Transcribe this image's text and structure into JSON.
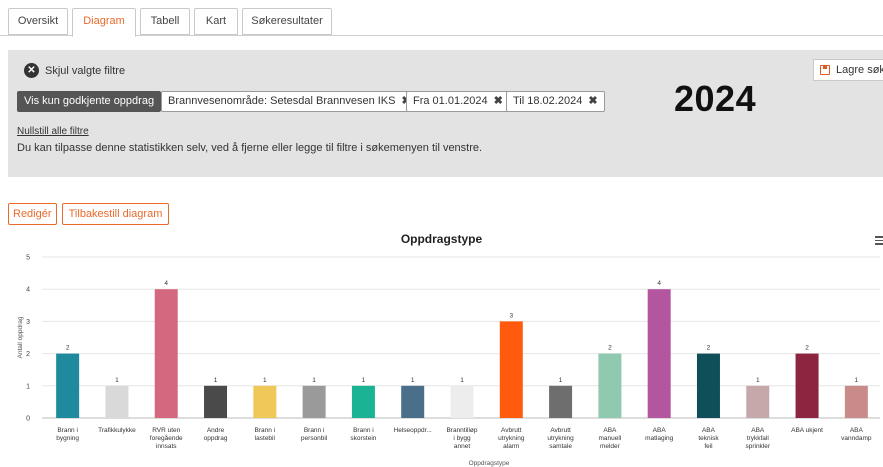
{
  "tabs": [
    {
      "label": "Oversikt",
      "active": false
    },
    {
      "label": "Diagram",
      "active": true
    },
    {
      "label": "Tabell",
      "active": false
    },
    {
      "label": "Kart",
      "active": false
    },
    {
      "label": "Søkeresultater",
      "active": false
    }
  ],
  "filters": {
    "hide_label": "Skjul valgte filtre",
    "approved_only_label": "Vis kun godkjente oppdrag",
    "chips": [
      {
        "label": "Brannvesenområde: Setesdal Brannvesen IKS"
      },
      {
        "label": "Fra 01.01.2024"
      },
      {
        "label": "Til 18.02.2024"
      }
    ],
    "reset_all_label": "Nullstill alle filtre",
    "hint_text": "Du kan tilpasse denne statistikken selv, ved å fjerne eller legge til filtre i søkemenyen til venstre.",
    "save_search_label": "Lagre søk"
  },
  "year_overlay": "2024",
  "buttons": {
    "edit_label": "Redigér",
    "reset_chart_label": "Tilbakestill diagram"
  },
  "chart_data": {
    "type": "bar",
    "title": "Oppdragstype",
    "xlabel": "Oppdragstype",
    "ylabel": "Antall oppdrag",
    "ylim": [
      0,
      5
    ],
    "yticks": [
      0,
      1,
      2,
      3,
      4,
      5
    ],
    "grid": true,
    "categories": [
      "Brann i bygning",
      "Trafikkulykke",
      "RVR uten foregående innsats",
      "Andre oppdrag",
      "Brann i lastebil",
      "Brann i personbil",
      "Brann i skorstein",
      "Helseoppdr...",
      "Branntilløp i bygg annet",
      "Avbrutt utrykning alarm",
      "Avbrutt utrykning samtale",
      "ABA manuell melder",
      "ABA matlaging",
      "ABA teknisk feil",
      "ABA trykkfall sprinkler",
      "ABA ukjent",
      "ABA vanndamp"
    ],
    "values": [
      2,
      1,
      4,
      1,
      1,
      1,
      1,
      1,
      1,
      3,
      1,
      2,
      4,
      2,
      1,
      2,
      1
    ],
    "colors": [
      "#1f8a9e",
      "#d9d9d9",
      "#d4687e",
      "#4a4a4a",
      "#f0c85a",
      "#9a9a9a",
      "#1ab394",
      "#4a6f8a",
      "#ededed",
      "#ff5a0e",
      "#6e6e6e",
      "#8fc9b0",
      "#b455a0",
      "#0f4f5a",
      "#c6a8ab",
      "#8b2540",
      "#c98a8a"
    ]
  }
}
